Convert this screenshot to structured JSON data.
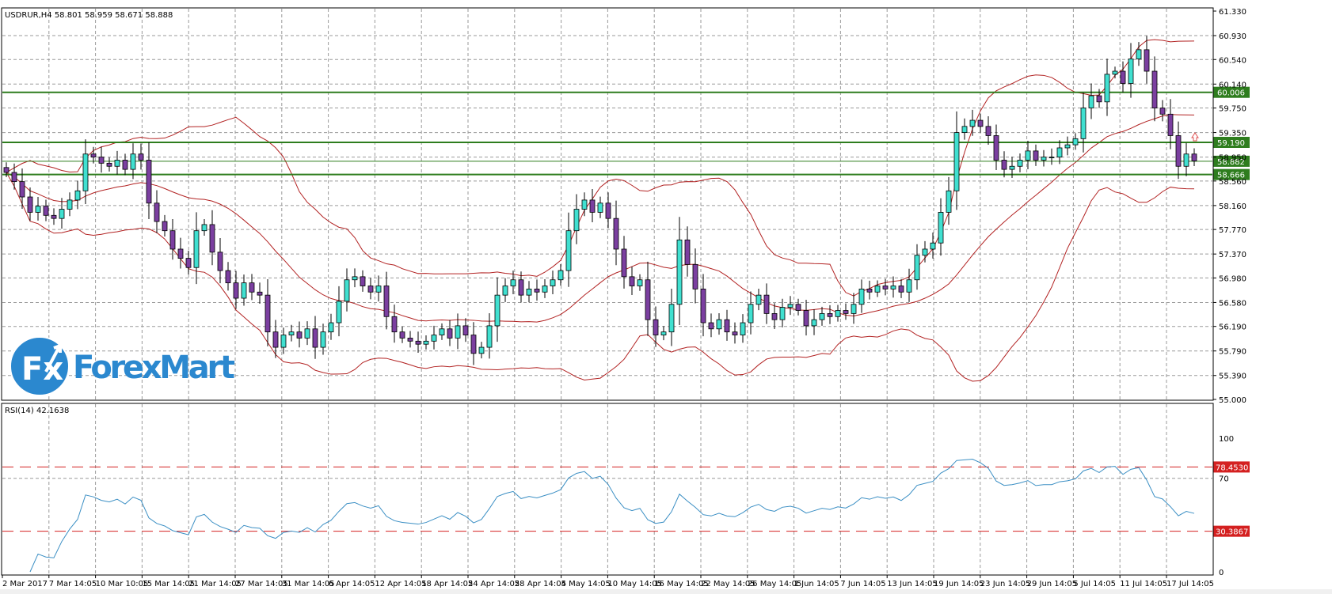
{
  "chart_data": {
    "type": "candlestick",
    "symbol_header": "USDRUR,H4  58.801 58.959 58.671 58.888",
    "ohlc_last": {
      "open": 58.801,
      "high": 58.959,
      "low": 58.671,
      "close": 58.888
    },
    "price_axis": {
      "range": [
        55.0,
        61.33
      ],
      "ticks": [
        "61.330",
        "60.930",
        "60.540",
        "60.140",
        "59.750",
        "59.350",
        "58.950",
        "58.560",
        "58.160",
        "57.770",
        "57.370",
        "56.980",
        "56.580",
        "56.190",
        "55.790",
        "55.390",
        "55.000"
      ]
    },
    "time_axis": {
      "ticks": [
        "2 Mar 2017",
        "7 Mar 14:05",
        "10 Mar 10:05",
        "15 Mar 14:05",
        "21 Mar 14:05",
        "27 Mar 14:05",
        "31 Mar 14:05",
        "6 Apr 14:05",
        "12 Apr 14:05",
        "18 Apr 14:05",
        "24 Apr 14:05",
        "28 Apr 14:05",
        "4 May 14:05",
        "10 May 14:05",
        "16 May 14:05",
        "22 May 14:05",
        "26 May 14:05",
        "1 Jun 14:05",
        "7 Jun 14:05",
        "13 Jun 14:05",
        "19 Jun 14:05",
        "23 Jun 14:05",
        "29 Jun 14:05",
        "5 Jul 14:05",
        "11 Jul 14:05",
        "17 Jul 14:05"
      ]
    },
    "closes": [
      58.7,
      58.55,
      58.3,
      58.05,
      58.15,
      58.0,
      57.95,
      58.1,
      58.25,
      58.4,
      59.0,
      58.95,
      58.85,
      58.8,
      58.9,
      58.75,
      59.0,
      58.9,
      58.2,
      57.9,
      57.75,
      57.45,
      57.3,
      57.15,
      57.75,
      57.85,
      57.4,
      57.1,
      56.9,
      56.65,
      56.9,
      56.75,
      56.7,
      56.1,
      55.85,
      56.05,
      56.1,
      56.0,
      56.15,
      55.85,
      56.1,
      56.25,
      56.6,
      56.95,
      57.0,
      56.85,
      56.75,
      56.85,
      56.35,
      56.1,
      56.0,
      55.95,
      55.9,
      55.95,
      56.05,
      56.15,
      56.0,
      56.2,
      56.05,
      55.75,
      55.85,
      56.2,
      56.7,
      56.85,
      56.95,
      56.7,
      56.8,
      56.75,
      56.85,
      56.95,
      57.1,
      57.75,
      58.1,
      58.25,
      58.05,
      58.2,
      57.95,
      57.45,
      57.0,
      56.85,
      56.95,
      56.3,
      56.05,
      56.1,
      56.55,
      57.6,
      57.2,
      56.8,
      56.25,
      56.15,
      56.3,
      56.1,
      56.05,
      56.25,
      56.55,
      56.7,
      56.4,
      56.3,
      56.5,
      56.55,
      56.45,
      56.2,
      56.3,
      56.4,
      56.35,
      56.45,
      56.4,
      56.55,
      56.8,
      56.75,
      56.85,
      56.8,
      56.85,
      56.75,
      56.95,
      57.35,
      57.45,
      57.55,
      58.05,
      58.4,
      59.35,
      59.45,
      59.55,
      59.45,
      59.3,
      58.9,
      58.75,
      58.8,
      58.9,
      59.05,
      58.9,
      58.95,
      58.95,
      59.1,
      59.15,
      59.25,
      59.75,
      59.95,
      59.85,
      60.3,
      60.35,
      60.15,
      60.55,
      60.7,
      60.35,
      59.75,
      59.65,
      59.3,
      58.8,
      59.0,
      58.888
    ],
    "levels": [
      {
        "value": 60.006,
        "label": "60.006"
      },
      {
        "value": 59.19,
        "label": "59.190"
      },
      {
        "value": 58.882,
        "label": "58.882"
      },
      {
        "value": 58.666,
        "label": "58.666"
      }
    ],
    "indicator_bands": {
      "name": "Bollinger Bands",
      "period": 20,
      "deviation": 2
    },
    "rsi": {
      "title": "RSI(14) 42.1638",
      "period": 14,
      "range": [
        0,
        100
      ],
      "ticks": [
        "100",
        "70",
        "0"
      ],
      "levels": [
        {
          "value": 78.453,
          "label": "78.4530"
        },
        {
          "value": 30.3867,
          "label": "30.3867"
        }
      ]
    },
    "colors": {
      "bull": "#40e0d0",
      "bear": "#7b3fa0",
      "band": "#b22222",
      "level": "#2e7d1e",
      "rsi": "#3b8fc4",
      "rsi_level": "#d42020",
      "logo": "#2b88cf"
    }
  },
  "logo": {
    "text": "ForexMart",
    "mark": "Fx"
  }
}
